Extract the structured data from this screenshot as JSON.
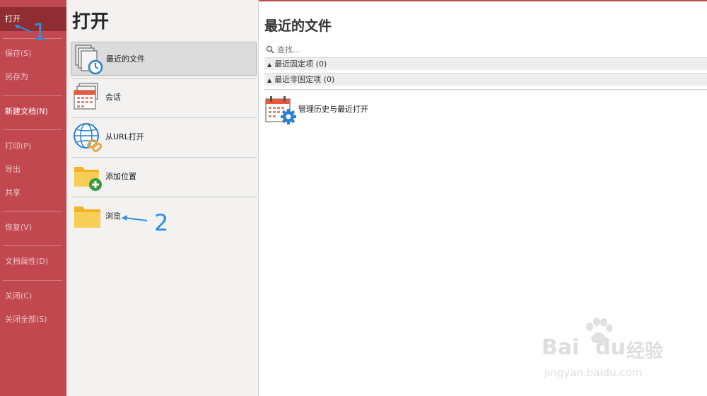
{
  "sidebar": {
    "items": [
      {
        "label": "打开",
        "state": "active"
      },
      {
        "label": "保存(S)",
        "state": "disabled"
      },
      {
        "label": "另存为",
        "state": "disabled"
      },
      {
        "label": "新建文档(N)",
        "state": "enabled"
      },
      {
        "label": "打印(P)",
        "state": "disabled"
      },
      {
        "label": "导出",
        "state": "disabled"
      },
      {
        "label": "共享",
        "state": "disabled"
      },
      {
        "label": "恢复(V)",
        "state": "disabled"
      },
      {
        "label": "文档属性(D)",
        "state": "disabled"
      },
      {
        "label": "关闭(C)",
        "state": "disabled"
      },
      {
        "label": "关闭全部(S)",
        "state": "disabled"
      }
    ]
  },
  "middle": {
    "title": "打开",
    "items": [
      {
        "label": "最近的文件",
        "icon": "recent-files-clock-icon",
        "selected": true
      },
      {
        "label": "会话",
        "icon": "session-calendar-icon",
        "selected": false
      },
      {
        "label": "从URL打开",
        "icon": "globe-link-icon",
        "selected": false
      },
      {
        "label": "添加位置",
        "icon": "folder-add-icon",
        "selected": false
      },
      {
        "label": "浏览",
        "icon": "folder-icon",
        "selected": false
      }
    ]
  },
  "right": {
    "title": "最近的文件",
    "search": {
      "placeholder": "查找..."
    },
    "groups": [
      {
        "label": "最近固定项 (0)"
      },
      {
        "label": "最近非固定项 (0)"
      }
    ],
    "manage": {
      "label": "管理历史与最近打开",
      "icon": "calendar-gear-icon"
    }
  },
  "annotations": {
    "step1": "1",
    "step2": "2"
  },
  "watermark": {
    "brand": "Bai",
    "brand2": "du",
    "suffix": "经验",
    "url": "jingyan.baidu.com"
  },
  "colors": {
    "sidebar": "#c1484f",
    "sidebar_active": "#8f2d33",
    "annotation": "#2f8fe0",
    "folder": "#f5c842"
  }
}
